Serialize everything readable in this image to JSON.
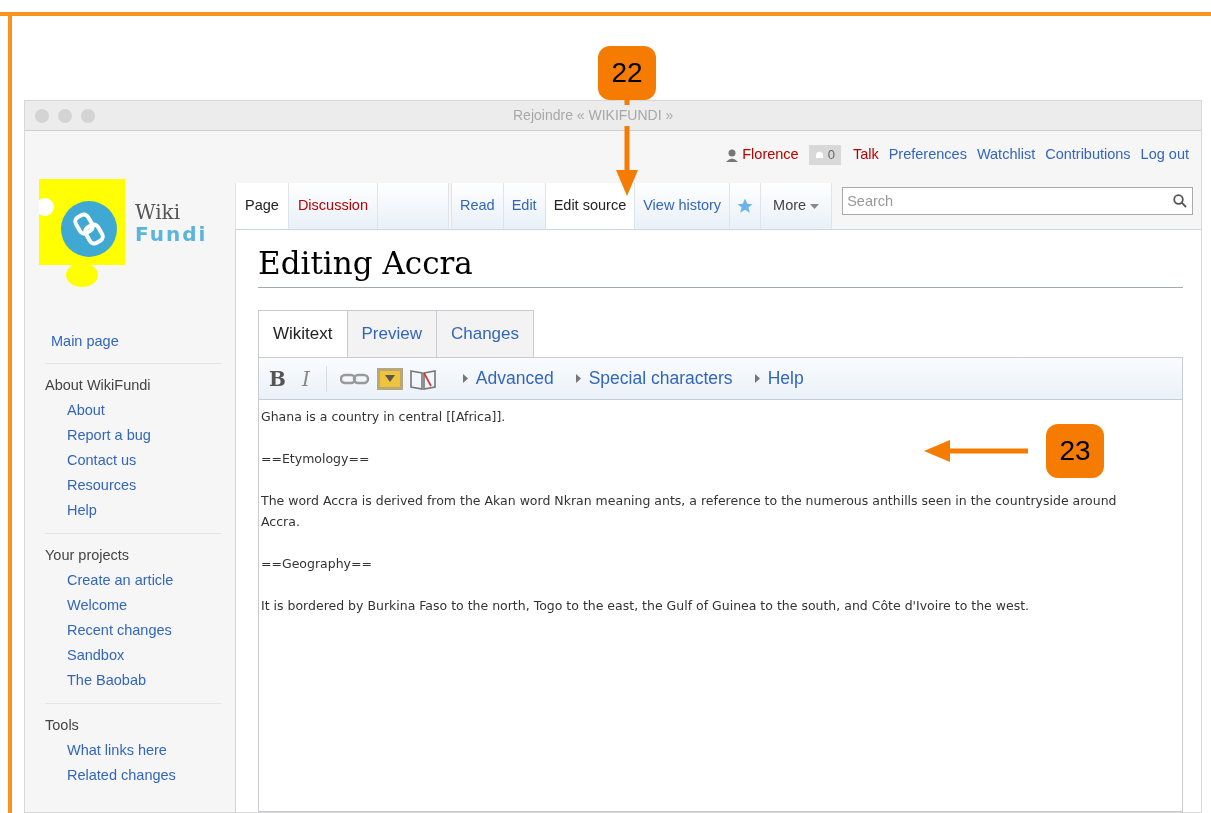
{
  "window": {
    "title": "Rejoindre « WIKIFUNDI »"
  },
  "user_bar": {
    "user": "Florence",
    "notifications": "0",
    "links": [
      {
        "label": "Talk",
        "missing": true
      },
      {
        "label": "Preferences",
        "missing": false
      },
      {
        "label": "Watchlist",
        "missing": false
      },
      {
        "label": "Contributions",
        "missing": false
      },
      {
        "label": "Log out",
        "missing": false
      }
    ]
  },
  "logo": {
    "line1": "Wiki",
    "line2": "Fundi"
  },
  "page_tabs": [
    {
      "label": "Page",
      "selected": true,
      "missing": false
    },
    {
      "label": "Discussion",
      "selected": false,
      "missing": true
    }
  ],
  "view_tabs": [
    {
      "label": "Read",
      "selected": false
    },
    {
      "label": "Edit",
      "selected": false
    },
    {
      "label": "Edit source",
      "selected": true
    },
    {
      "label": "View history",
      "selected": false
    }
  ],
  "more": "More",
  "search": {
    "placeholder": "Search"
  },
  "heading": "Editing Accra",
  "editor_tabs": [
    {
      "label": "Wikitext",
      "selected": true
    },
    {
      "label": "Preview",
      "selected": false
    },
    {
      "label": "Changes",
      "selected": false
    }
  ],
  "toolbar": {
    "bold": "B",
    "italic": "I",
    "menus": [
      "Advanced",
      "Special characters",
      "Help"
    ]
  },
  "editor_text": [
    "Ghana is a country in central [[Africa]].",
    "==Etymology==",
    "The word Accra is derived from the Akan word Nkran meaning ants, a reference to the numerous anthills seen in the countryside around Accra.",
    "==Geography==",
    "It is bordered by Burkina Faso to the north, Togo to the east, the Gulf of Guinea to the south, and Côte d'Ivoire to the west."
  ],
  "sidebar": {
    "main": "Main page",
    "sections": [
      {
        "title": "About WikiFundi",
        "items": [
          "About",
          "Report a bug",
          "Contact us",
          "Resources",
          "Help"
        ]
      },
      {
        "title": "Your projects",
        "items": [
          "Create an article",
          "Welcome",
          "Recent changes",
          "Sandbox",
          "The Baobab"
        ]
      },
      {
        "title": "Tools",
        "items": [
          "What links here",
          "Related changes"
        ]
      }
    ]
  },
  "callouts": [
    {
      "number": "22",
      "kind": "down"
    },
    {
      "number": "23",
      "kind": "left"
    }
  ]
}
